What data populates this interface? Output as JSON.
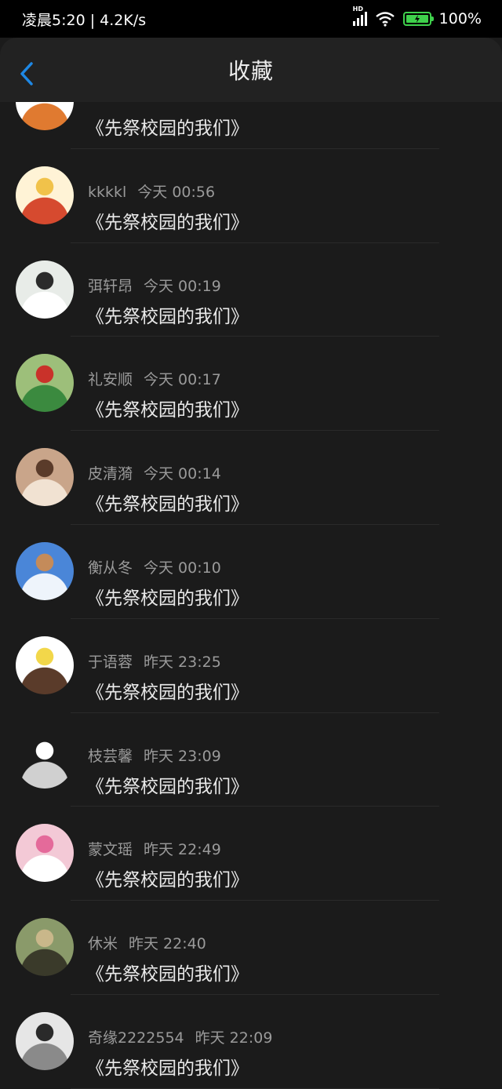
{
  "status_bar": {
    "time": "凌晨5:20 | 4.2K/s",
    "signal_badge": "HD",
    "battery": "100%"
  },
  "header": {
    "title": "收藏",
    "back_icon": "chevron-left-icon"
  },
  "accent_color": "#1e88e5",
  "items": [
    {
      "user": "",
      "time": "",
      "book": "《先祭校园的我们》",
      "avatar_colors": [
        "#ffffff",
        "#e07a30",
        "#111111"
      ]
    },
    {
      "user": "kkkkl",
      "time": "今天 00:56",
      "book": "《先祭校园的我们》",
      "avatar_colors": [
        "#fff3d6",
        "#d64a2f",
        "#f1c24a"
      ]
    },
    {
      "user": "弭轩昂",
      "time": "今天 00:19",
      "book": "《先祭校园的我们》",
      "avatar_colors": [
        "#e8ece8",
        "#ffffff",
        "#2b2b2b"
      ]
    },
    {
      "user": "礼安顺",
      "time": "今天 00:17",
      "book": "《先祭校园的我们》",
      "avatar_colors": [
        "#9dbf7a",
        "#3b8a3f",
        "#c9322a"
      ]
    },
    {
      "user": "皮清漪",
      "time": "今天 00:14",
      "book": "《先祭校园的我们》",
      "avatar_colors": [
        "#c9a58a",
        "#f1e2d2",
        "#5a3b2a"
      ]
    },
    {
      "user": "衡从冬",
      "time": "今天 00:10",
      "book": "《先祭校园的我们》",
      "avatar_colors": [
        "#4a86d8",
        "#eef4fb",
        "#c48b5a"
      ]
    },
    {
      "user": "于语蓉",
      "time": "昨天 23:25",
      "book": "《先祭校园的我们》",
      "avatar_colors": [
        "#ffffff",
        "#5a3b2a",
        "#f2d74a"
      ]
    },
    {
      "user": "枝芸馨",
      "time": "昨天 23:09",
      "book": "《先祭校园的我们》",
      "avatar_colors": [
        "#1b1b1b",
        "#d0d0d0",
        "#ffffff"
      ]
    },
    {
      "user": "蒙文瑶",
      "time": "昨天 22:49",
      "book": "《先祭校园的我们》",
      "avatar_colors": [
        "#f3c9d6",
        "#ffffff",
        "#e46a9a"
      ]
    },
    {
      "user": "休米",
      "time": "昨天 22:40",
      "book": "《先祭校园的我们》",
      "avatar_colors": [
        "#8a9a6a",
        "#3a3a2a",
        "#c9b78a"
      ]
    },
    {
      "user": "奇缘2222554",
      "time": "昨天 22:09",
      "book": "《先祭校园的我们》",
      "avatar_colors": [
        "#e6e6e6",
        "#8a8a8a",
        "#2a2a2a"
      ]
    }
  ]
}
